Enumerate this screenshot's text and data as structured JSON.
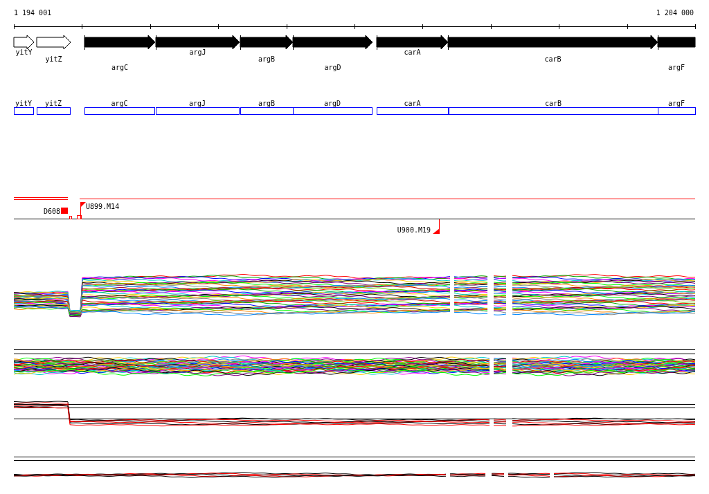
{
  "ruler": {
    "start": "1 194 001",
    "end": "1 204 000"
  },
  "genes": [
    {
      "name": "yitY",
      "kind": "outline"
    },
    {
      "name": "yitZ",
      "kind": "outline"
    },
    {
      "name": "argC",
      "kind": "solid"
    },
    {
      "name": "argJ",
      "kind": "solid"
    },
    {
      "name": "argB",
      "kind": "solid"
    },
    {
      "name": "argD",
      "kind": "solid"
    },
    {
      "name": "carA",
      "kind": "solid"
    },
    {
      "name": "carB",
      "kind": "solid"
    },
    {
      "name": "argF",
      "kind": "solid"
    }
  ],
  "gene_boxes": [
    {
      "name": "yitY"
    },
    {
      "name": "yitZ"
    },
    {
      "name": "argC"
    },
    {
      "name": "argJ"
    },
    {
      "name": "argB"
    },
    {
      "name": "argD"
    },
    {
      "name": "carA"
    },
    {
      "name": "carB"
    },
    {
      "name": "argF"
    }
  ],
  "markers": [
    {
      "label": "D608",
      "kind": "block"
    },
    {
      "label": "U899.M14",
      "kind": "flag-up"
    },
    {
      "label": "U900.M19",
      "kind": "flag-down"
    }
  ]
}
